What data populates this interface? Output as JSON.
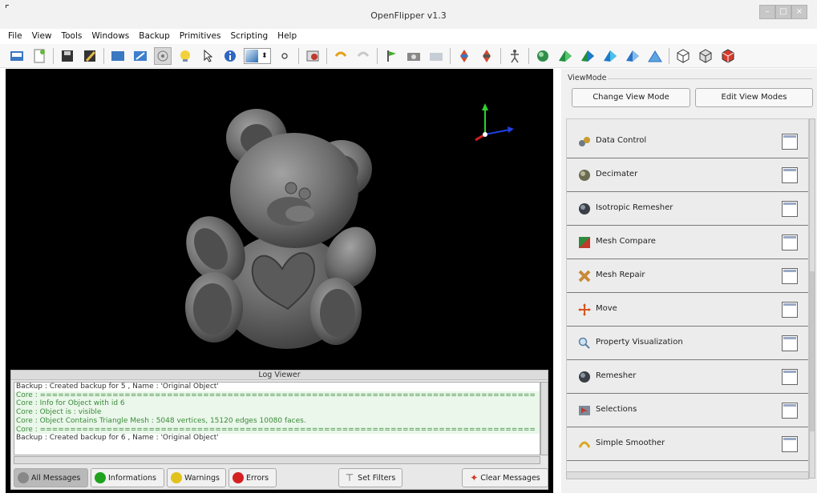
{
  "window": {
    "title": "OpenFlipper v1.3"
  },
  "menubar": [
    "File",
    "View",
    "Tools",
    "Windows",
    "Backup",
    "Primitives",
    "Scripting",
    "Help"
  ],
  "log_viewer": {
    "title": "Log Viewer",
    "lines": [
      "Backup : Created backup for 5 , Name : 'Original Object'",
      "Core : ==================================================================================",
      "Core : Info for Object with id 6",
      "Core : Object is : visible",
      "Core : Object Contains Triangle Mesh : 5048 vertices, 15120 edges 10080 faces.",
      "Core : ==================================================================================",
      "Backup : Created backup for 6 , Name : 'Original Object'"
    ],
    "buttons": {
      "all": "All Messages",
      "info": "Informations",
      "warnings": "Warnings",
      "errors": "Errors",
      "filters": "Set Filters",
      "clear": "Clear Messages"
    }
  },
  "viewmode": {
    "label": "ViewMode",
    "change": "Change View Mode",
    "edit": "Edit View Modes"
  },
  "toolboxes": [
    "Data Control",
    "Decimater",
    "Isotropic Remesher",
    "Mesh Compare",
    "Mesh Repair",
    "Move",
    "Property Visualization",
    "Remesher",
    "Selections",
    "Simple Smoother"
  ],
  "colors": {
    "viewer_bg": "#000000",
    "log_green": "#3a8a3a",
    "error_red": "#d42222",
    "ok_green": "#1fa31f",
    "warn_yellow": "#e2c21a"
  }
}
